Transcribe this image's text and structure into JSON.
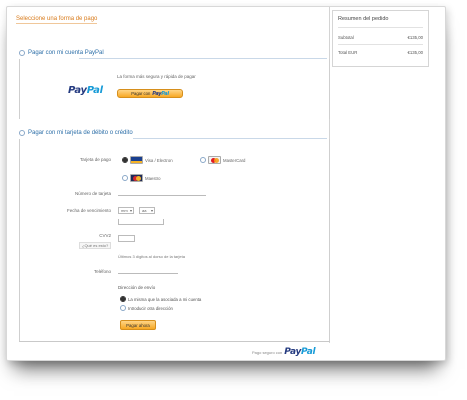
{
  "page": {
    "title": "Seleccione una forma de pago"
  },
  "paypal_section": {
    "heading": "Pagar con mi cuenta PayPal",
    "logo_part1": "Pay",
    "logo_part2": "Pal",
    "description": "La forma más segura y rápida de pagar",
    "button_prefix": "Pagar con",
    "button_logo_part1": "Pay",
    "button_logo_part2": "Pal"
  },
  "card_section": {
    "heading": "Pagar con mi tarjeta de débito o crédito",
    "card_type_label": "Tarjeta de pago",
    "card_options": [
      {
        "name": "Visa / Electron",
        "icon": "visa-icon",
        "selected": true
      },
      {
        "name": "MasterCard",
        "icon": "mastercard-icon",
        "selected": false
      },
      {
        "name": "Maestro",
        "icon": "maestro-icon",
        "selected": false
      }
    ],
    "card_number_label": "Número de tarjeta",
    "expiry_label": "Fecha de vencimiento",
    "expiry_month": "mm",
    "expiry_year": "aa",
    "cvv_label": "CVV2",
    "cvv_help": "¿Qué es esto?",
    "cvv_note": "Últimos 3 dígitos al dorso de la tarjeta",
    "phone_label": "Teléfono",
    "contact_heading": "Dirección de envío",
    "contact_options": [
      {
        "label": "La misma que la asociada a mi cuenta",
        "selected": true
      },
      {
        "label": "Introducir otra dirección",
        "selected": false
      }
    ],
    "pay_button": "Pagar ahora"
  },
  "footer": {
    "prefix": "Pago seguro con",
    "logo_part1": "Pay",
    "logo_part2": "Pal"
  },
  "summary": {
    "title": "Resumen del pedido",
    "rows": [
      {
        "label": "Subtotal",
        "value": "€135,00"
      },
      {
        "label": "Total EUR",
        "value": "€135,00"
      }
    ]
  },
  "colors": {
    "accent_orange": "#d87a1a",
    "link_blue": "#2d6fa8",
    "paypal_dark": "#253b80",
    "paypal_light": "#179bd7",
    "button_gold": "#f7a824"
  }
}
